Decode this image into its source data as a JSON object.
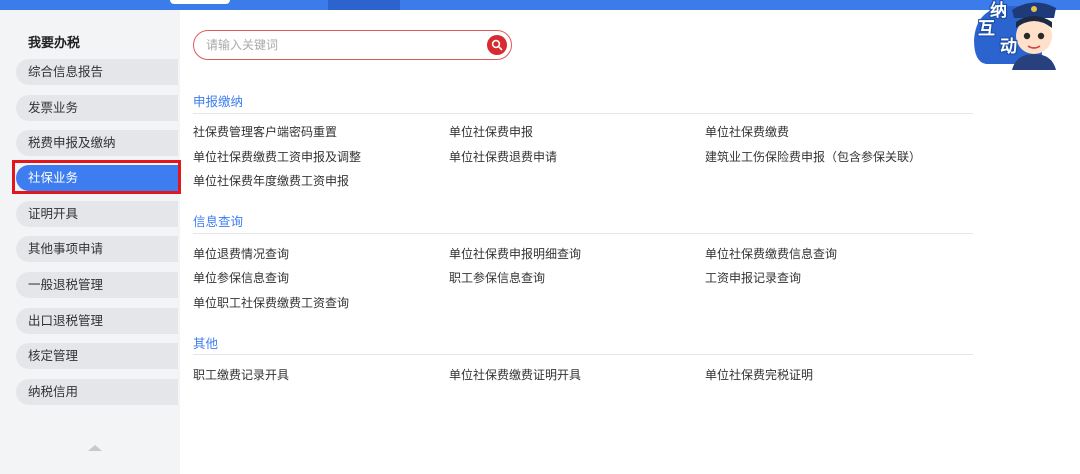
{
  "sidebar": {
    "title": "我要办税",
    "items": [
      {
        "label": "综合信息报告"
      },
      {
        "label": "发票业务"
      },
      {
        "label": "税费申报及缴纳"
      },
      {
        "label": "社保业务",
        "active": true
      },
      {
        "label": "证明开具"
      },
      {
        "label": "其他事项申请"
      },
      {
        "label": "一般退税管理"
      },
      {
        "label": "出口退税管理"
      },
      {
        "label": "核定管理"
      },
      {
        "label": "纳税信用"
      }
    ]
  },
  "search": {
    "placeholder": "请输入关键词"
  },
  "sections": [
    {
      "title": "申报缴纳",
      "links": [
        "社保费管理客户端密码重置",
        "单位社保费申报",
        "单位社保费缴费",
        "单位社保费缴费工资申报及调整",
        "单位社保费退费申请",
        "建筑业工伤保险费申报（包含参保关联）",
        "单位社保费年度缴费工资申报"
      ]
    },
    {
      "title": "信息查询",
      "links": [
        "单位退费情况查询",
        "单位社保费申报明细查询",
        "单位社保费缴费信息查询",
        "单位参保信息查询",
        "职工参保信息查询",
        "工资申报记录查询",
        "单位职工社保费缴费工资查询"
      ]
    },
    {
      "title": "其他",
      "links": [
        "职工缴费记录开具",
        "单位社保费缴费证明开具",
        "单位社保费完税证明"
      ]
    }
  ],
  "mascot": {
    "char1": "纳",
    "char2": "互",
    "char3": "动"
  },
  "colors": {
    "accent": "#3d7df0",
    "highlight": "#e3151d",
    "search_border": "#e0585b"
  }
}
